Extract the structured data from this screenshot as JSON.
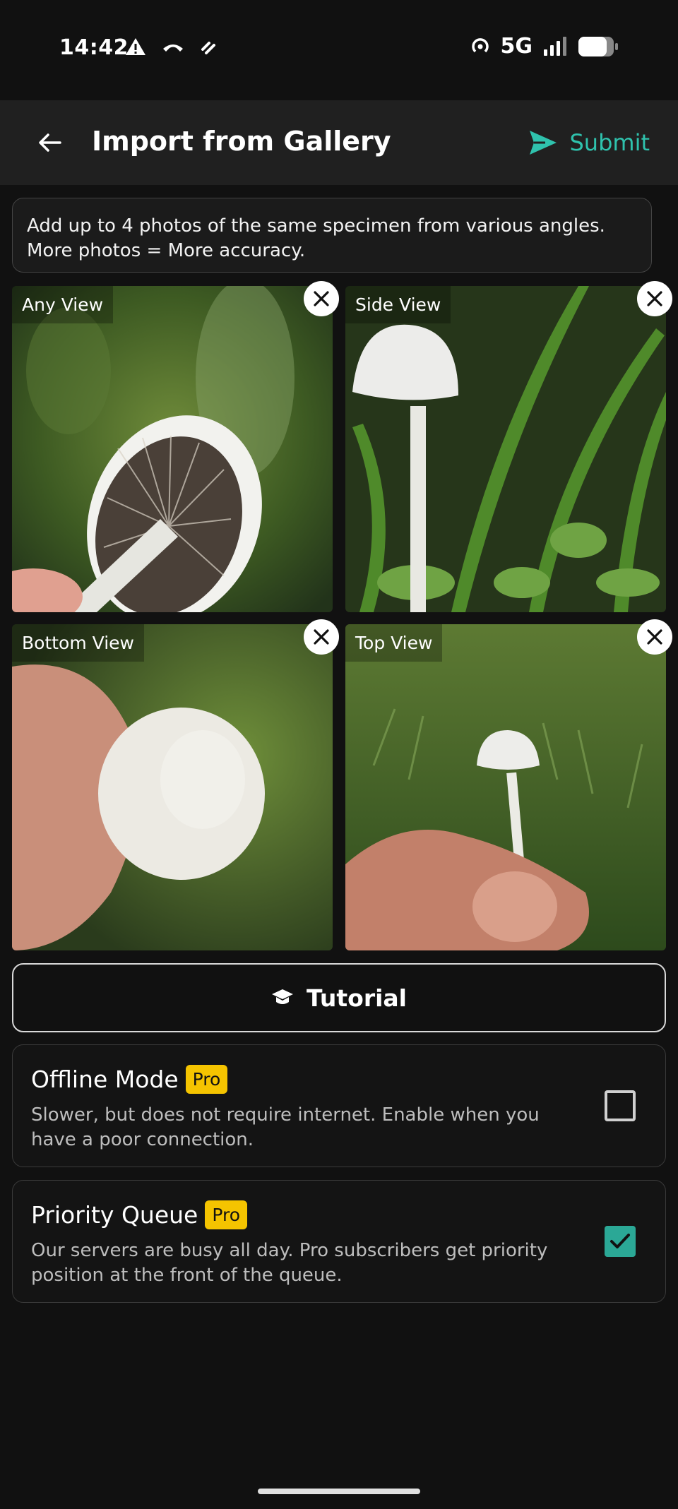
{
  "status_bar": {
    "time": "14:42",
    "left_icons": [
      "warning-icon",
      "missed-call-icon",
      "link-icon"
    ],
    "network": "5G",
    "right_icons": [
      "hotspot-icon",
      "signal-icon",
      "battery-icon"
    ]
  },
  "app_bar": {
    "title": "Import from Gallery",
    "submit_label": "Submit",
    "accent_color": "#2fc2ad"
  },
  "info_text": "Add up to 4 photos of the same specimen from various angles. More photos = More accuracy.",
  "photos": [
    {
      "label": "Any View"
    },
    {
      "label": "Side View"
    },
    {
      "label": "Bottom View"
    },
    {
      "label": "Top View"
    }
  ],
  "tutorial_label": "Tutorial",
  "options": [
    {
      "title": "Offline Mode",
      "badge": "Pro",
      "description": "Slower, but does not require internet. Enable when you have a poor connection.",
      "checked": false
    },
    {
      "title": "Priority Queue",
      "badge": "Pro",
      "description": "Our servers are busy all day. Pro subscribers get priority position at the front of the queue.",
      "checked": true
    }
  ]
}
